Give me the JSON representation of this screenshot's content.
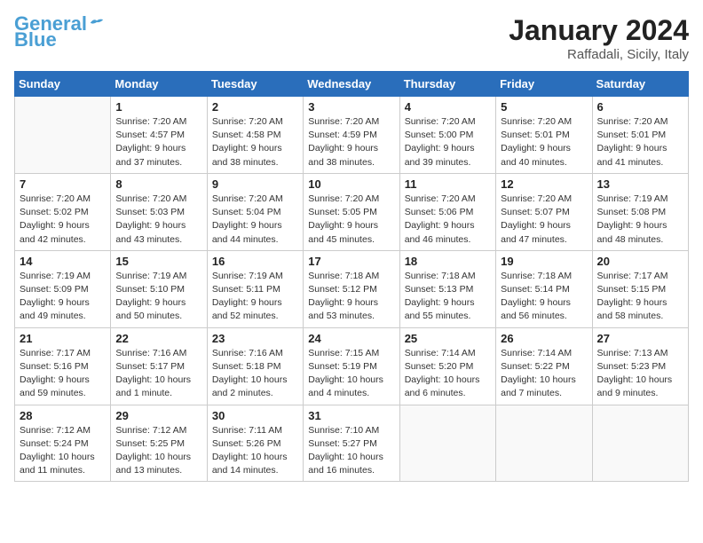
{
  "header": {
    "logo_line1": "General",
    "logo_line2": "Blue",
    "month_year": "January 2024",
    "location": "Raffadali, Sicily, Italy"
  },
  "weekdays": [
    "Sunday",
    "Monday",
    "Tuesday",
    "Wednesday",
    "Thursday",
    "Friday",
    "Saturday"
  ],
  "weeks": [
    [
      {
        "day": "",
        "info": ""
      },
      {
        "day": "1",
        "info": "Sunrise: 7:20 AM\nSunset: 4:57 PM\nDaylight: 9 hours\nand 37 minutes."
      },
      {
        "day": "2",
        "info": "Sunrise: 7:20 AM\nSunset: 4:58 PM\nDaylight: 9 hours\nand 38 minutes."
      },
      {
        "day": "3",
        "info": "Sunrise: 7:20 AM\nSunset: 4:59 PM\nDaylight: 9 hours\nand 38 minutes."
      },
      {
        "day": "4",
        "info": "Sunrise: 7:20 AM\nSunset: 5:00 PM\nDaylight: 9 hours\nand 39 minutes."
      },
      {
        "day": "5",
        "info": "Sunrise: 7:20 AM\nSunset: 5:01 PM\nDaylight: 9 hours\nand 40 minutes."
      },
      {
        "day": "6",
        "info": "Sunrise: 7:20 AM\nSunset: 5:01 PM\nDaylight: 9 hours\nand 41 minutes."
      }
    ],
    [
      {
        "day": "7",
        "info": "Sunrise: 7:20 AM\nSunset: 5:02 PM\nDaylight: 9 hours\nand 42 minutes."
      },
      {
        "day": "8",
        "info": "Sunrise: 7:20 AM\nSunset: 5:03 PM\nDaylight: 9 hours\nand 43 minutes."
      },
      {
        "day": "9",
        "info": "Sunrise: 7:20 AM\nSunset: 5:04 PM\nDaylight: 9 hours\nand 44 minutes."
      },
      {
        "day": "10",
        "info": "Sunrise: 7:20 AM\nSunset: 5:05 PM\nDaylight: 9 hours\nand 45 minutes."
      },
      {
        "day": "11",
        "info": "Sunrise: 7:20 AM\nSunset: 5:06 PM\nDaylight: 9 hours\nand 46 minutes."
      },
      {
        "day": "12",
        "info": "Sunrise: 7:20 AM\nSunset: 5:07 PM\nDaylight: 9 hours\nand 47 minutes."
      },
      {
        "day": "13",
        "info": "Sunrise: 7:19 AM\nSunset: 5:08 PM\nDaylight: 9 hours\nand 48 minutes."
      }
    ],
    [
      {
        "day": "14",
        "info": "Sunrise: 7:19 AM\nSunset: 5:09 PM\nDaylight: 9 hours\nand 49 minutes."
      },
      {
        "day": "15",
        "info": "Sunrise: 7:19 AM\nSunset: 5:10 PM\nDaylight: 9 hours\nand 50 minutes."
      },
      {
        "day": "16",
        "info": "Sunrise: 7:19 AM\nSunset: 5:11 PM\nDaylight: 9 hours\nand 52 minutes."
      },
      {
        "day": "17",
        "info": "Sunrise: 7:18 AM\nSunset: 5:12 PM\nDaylight: 9 hours\nand 53 minutes."
      },
      {
        "day": "18",
        "info": "Sunrise: 7:18 AM\nSunset: 5:13 PM\nDaylight: 9 hours\nand 55 minutes."
      },
      {
        "day": "19",
        "info": "Sunrise: 7:18 AM\nSunset: 5:14 PM\nDaylight: 9 hours\nand 56 minutes."
      },
      {
        "day": "20",
        "info": "Sunrise: 7:17 AM\nSunset: 5:15 PM\nDaylight: 9 hours\nand 58 minutes."
      }
    ],
    [
      {
        "day": "21",
        "info": "Sunrise: 7:17 AM\nSunset: 5:16 PM\nDaylight: 9 hours\nand 59 minutes."
      },
      {
        "day": "22",
        "info": "Sunrise: 7:16 AM\nSunset: 5:17 PM\nDaylight: 10 hours\nand 1 minute."
      },
      {
        "day": "23",
        "info": "Sunrise: 7:16 AM\nSunset: 5:18 PM\nDaylight: 10 hours\nand 2 minutes."
      },
      {
        "day": "24",
        "info": "Sunrise: 7:15 AM\nSunset: 5:19 PM\nDaylight: 10 hours\nand 4 minutes."
      },
      {
        "day": "25",
        "info": "Sunrise: 7:14 AM\nSunset: 5:20 PM\nDaylight: 10 hours\nand 6 minutes."
      },
      {
        "day": "26",
        "info": "Sunrise: 7:14 AM\nSunset: 5:22 PM\nDaylight: 10 hours\nand 7 minutes."
      },
      {
        "day": "27",
        "info": "Sunrise: 7:13 AM\nSunset: 5:23 PM\nDaylight: 10 hours\nand 9 minutes."
      }
    ],
    [
      {
        "day": "28",
        "info": "Sunrise: 7:12 AM\nSunset: 5:24 PM\nDaylight: 10 hours\nand 11 minutes."
      },
      {
        "day": "29",
        "info": "Sunrise: 7:12 AM\nSunset: 5:25 PM\nDaylight: 10 hours\nand 13 minutes."
      },
      {
        "day": "30",
        "info": "Sunrise: 7:11 AM\nSunset: 5:26 PM\nDaylight: 10 hours\nand 14 minutes."
      },
      {
        "day": "31",
        "info": "Sunrise: 7:10 AM\nSunset: 5:27 PM\nDaylight: 10 hours\nand 16 minutes."
      },
      {
        "day": "",
        "info": ""
      },
      {
        "day": "",
        "info": ""
      },
      {
        "day": "",
        "info": ""
      }
    ]
  ]
}
